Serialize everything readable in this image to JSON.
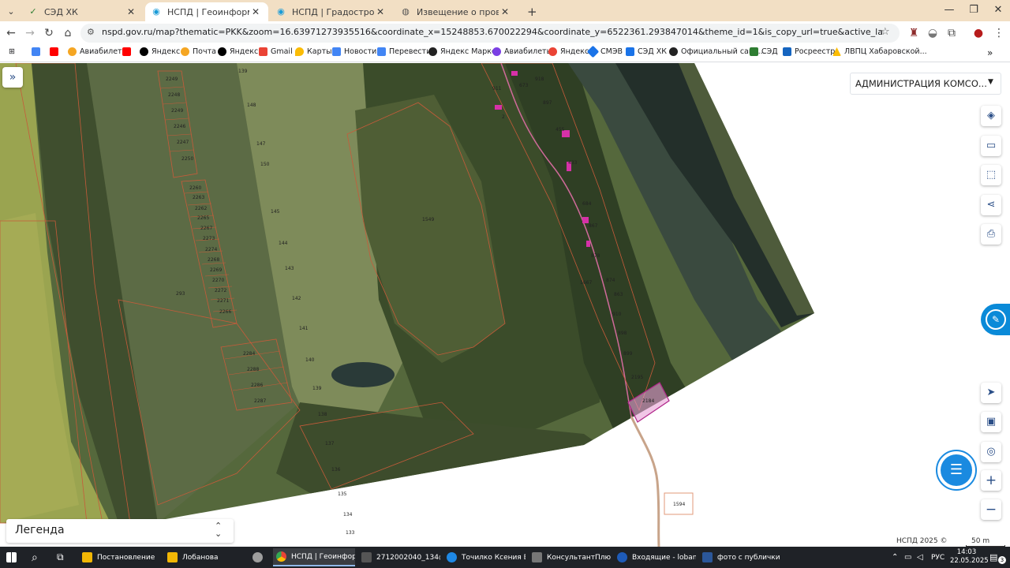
{
  "browser": {
    "tabs": [
      {
        "label": "СЭД ХК",
        "icon": "sed-icon",
        "active": false
      },
      {
        "label": "НСПД | Геоинформационный",
        "icon": "nspd-icon",
        "active": true
      },
      {
        "label": "НСПД | Градостроительная пр",
        "icon": "nspd-icon",
        "active": false
      },
      {
        "label": "Извещение о проведении аук",
        "icon": "globe-icon",
        "active": false
      }
    ],
    "url": "nspd.gov.ru/map?thematic=PKK&zoom=16.63971273935516&coordinate_x=15248853.670022294&coordinate_y=6522361.293847014&theme_id=1&is_copy_url=true&active_layers=36329%2C36328%2C36049%2C36473%2C849453%2..."
  },
  "bookmarks": [
    {
      "label": "",
      "color": "#4285f4"
    },
    {
      "label": "",
      "color": "#ff0000"
    },
    {
      "label": "Авиабилеты",
      "color": "#f5a623"
    },
    {
      "label": "",
      "color": "#ff0000"
    },
    {
      "label": "Яндекс",
      "color": "#000000"
    },
    {
      "label": "Почта",
      "color": "#f5a623"
    },
    {
      "label": "Яндекс",
      "color": "#000000"
    },
    {
      "label": "Gmail",
      "color": "#ea4335"
    },
    {
      "label": "Карты",
      "color": "#fbbc05"
    },
    {
      "label": "Новости",
      "color": "#4285f4"
    },
    {
      "label": "Перевести",
      "color": "#4285f4"
    },
    {
      "label": "Яндекс Маркет",
      "color": "#222222"
    },
    {
      "label": "Авиабилеты",
      "color": "#7b3fe4"
    },
    {
      "label": "Яндекс",
      "color": "#ea4335"
    },
    {
      "label": "СМЭВ",
      "color": "#1a73e8"
    },
    {
      "label": "СЭД ХК",
      "color": "#1a73e8"
    },
    {
      "label": "Официальный сайт...",
      "color": "#222222"
    },
    {
      "label": "СЭД",
      "color": "#2e7d32"
    },
    {
      "label": "Росреестр",
      "color": "#1565c0"
    },
    {
      "label": "ЛВПЦ Хабаровской...",
      "color": "#fbbc05"
    }
  ],
  "map": {
    "org_select": "АДМИНИСТРАЦИЯ КОМСО...",
    "legend": "Легенда",
    "copyright": "НСПД 2025 ©",
    "scale": "50 m",
    "plots": {
      "left_column": [
        "2249",
        "2248",
        "2249",
        "2246",
        "2247",
        "2250"
      ],
      "middle_column": [
        "2260",
        "2263",
        "2262",
        "2265",
        "2267",
        "2273",
        "2274",
        "2268",
        "2269",
        "2270",
        "2272",
        "2271",
        "2266"
      ],
      "lower_group": [
        "2284",
        "2288",
        "2286",
        "2287"
      ],
      "field_line": [
        "139",
        "148",
        "147",
        "150",
        "145",
        "144",
        "143",
        "142",
        "141",
        "140",
        "139",
        "138",
        "137",
        "136",
        "135",
        "134",
        "133"
      ],
      "forest": "1549",
      "left_misc": "293",
      "river_strip": [
        "911",
        "673",
        "918",
        "897",
        "455",
        "433",
        "684",
        "867",
        "878",
        "1667",
        "874",
        "863",
        "910",
        "898",
        "899",
        "2195",
        "2184"
      ],
      "road": "1594",
      "village_small": "2"
    }
  },
  "taskbar": {
    "items": [
      {
        "label": "Постановление",
        "color": "#f2b705"
      },
      {
        "label": "Лобанова",
        "color": "#f2b705"
      },
      {
        "label": "",
        "color": "#9e9e9e"
      },
      {
        "label": "НСПД | Геоинфор...",
        "color": "#34a853"
      },
      {
        "label": "2712002040_134@г...",
        "color": "#555555"
      },
      {
        "label": "Точилко Ксения В...",
        "color": "#1e88e5"
      },
      {
        "label": "КонсультантПлюс...",
        "color": "#777777"
      },
      {
        "label": "Входящие - loban...",
        "color": "#1e5bb8"
      },
      {
        "label": "фото с публички -...",
        "color": "#2b579a"
      }
    ],
    "lang": "РУС",
    "time": "14:03",
    "date": "22.05.2025",
    "notifications": "3"
  }
}
